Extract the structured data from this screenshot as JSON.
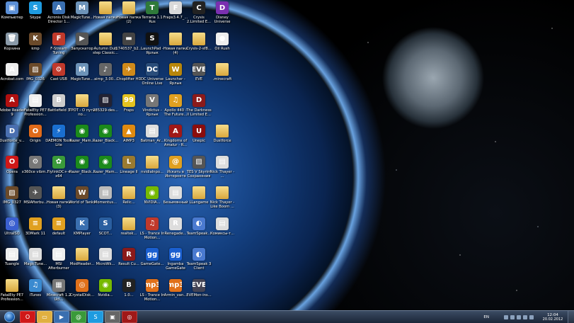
{
  "desktop_icons": [
    {
      "label": "Компьютер",
      "color": "#5b8fd6",
      "glyph": "▣",
      "name": "computer-icon"
    },
    {
      "label": "Skype",
      "color": "#1e9be0",
      "glyph": "S",
      "name": "skype-icon"
    },
    {
      "label": "Acronis Disk Director 1...",
      "color": "#3a6fb0",
      "glyph": "A",
      "name": "acronis-icon"
    },
    {
      "label": "MagicTune...",
      "color": "#6d93b8",
      "glyph": "M",
      "name": "magictune-icon"
    },
    {
      "label": "Новая папка",
      "color": "folder",
      "glyph": "",
      "name": "folder-icon"
    },
    {
      "label": "Новая папка (2)",
      "color": "folder",
      "glyph": "",
      "name": "folder-icon"
    },
    {
      "label": "Terraria 1.1 Rus",
      "color": "#2f7a3a",
      "glyph": "T",
      "name": "terraria-icon"
    },
    {
      "label": "Fraps3.4.7_...",
      "color": "#d9d9d9",
      "glyph": "F",
      "name": "fraps-installer-icon"
    },
    {
      "label": "Crysis 2.Limited E...",
      "color": "#222",
      "glyph": "C",
      "name": "crysis-icon"
    },
    {
      "label": "Disney Universe",
      "color": "#7a2fb0",
      "glyph": "D",
      "name": "disney-icon"
    },
    {
      "label": "Корзина",
      "color": "#8a9aa8",
      "glyph": "🗑",
      "name": "recycle-bin-icon"
    },
    {
      "label": "kmp",
      "color": "#6b4a2a",
      "glyph": "K",
      "name": "kmp-icon"
    },
    {
      "label": "F-Stream Tuning",
      "color": "#c0392b",
      "glyph": "F",
      "name": "fstream-icon"
    },
    {
      "label": "Запускатор",
      "color": "#555",
      "glyph": "▶",
      "name": "launcher-icon"
    },
    {
      "label": "Autumn Dub step Classic...",
      "color": "folder",
      "glyph": "",
      "name": "folder-icon"
    },
    {
      "label": "1740537_b2...",
      "color": "#444",
      "glyph": "▬",
      "name": "file-icon"
    },
    {
      "label": "LaunchPad - Ярлык",
      "color": "#111",
      "glyph": "S",
      "name": "launchpad-icon"
    },
    {
      "label": "Новая папка (4)",
      "color": "folder",
      "glyph": "",
      "name": "folder-icon"
    },
    {
      "label": "Crysis-2-sf8...",
      "color": "folder",
      "glyph": "",
      "name": "folder-icon"
    },
    {
      "label": "Oil Rush",
      "color": "#eee",
      "glyph": "●",
      "name": "oilrush-icon"
    },
    {
      "label": "Acrobat.com",
      "color": "#eee",
      "glyph": "A",
      "name": "acrobat-icon"
    },
    {
      "label": "IMG_0326",
      "color": "#6b4a2a",
      "glyph": "▨",
      "name": "image-file-icon"
    },
    {
      "label": "Cast USB",
      "color": "#c0392b",
      "glyph": "⚙",
      "name": "castusb-icon"
    },
    {
      "label": "MagicTune...",
      "color": "#6d93b8",
      "glyph": "M",
      "name": "magictune-icon"
    },
    {
      "label": "aimp_3.00...",
      "color": "#666",
      "glyph": "♪",
      "name": "aimp-installer-icon"
    },
    {
      "label": "Choplifter HD",
      "color": "#d08a1a",
      "glyph": "✈",
      "name": "choplifter-icon"
    },
    {
      "label": "DC Universe Online Live",
      "color": "#2a4d7a",
      "glyph": "DC",
      "name": "dcuo-icon"
    },
    {
      "label": "Launcher - Ярлык",
      "color": "#b8860b",
      "glyph": "W",
      "name": "wow-launcher-icon"
    },
    {
      "label": "EVE",
      "color": "#555",
      "glyph": "EVE",
      "name": "eve-icon"
    },
    {
      "label": ".minecraft",
      "color": "folder",
      "glyph": "",
      "name": "folder-icon"
    },
    {
      "label": "Adobe Reader 9",
      "color": "#b01010",
      "glyph": "A",
      "name": "adobe-reader-icon"
    },
    {
      "label": "FatalEty PE7 Profession...",
      "color": "#eee",
      "glyph": "▤",
      "name": "document-icon"
    },
    {
      "label": "Battlefield 3",
      "color": "#ccc",
      "glyph": "B",
      "name": "battlefield-icon"
    },
    {
      "label": "ТРОТ - О пути по...",
      "color": "folder",
      "glyph": "",
      "name": "folder-icon"
    },
    {
      "label": "285329-des...",
      "color": "#223",
      "glyph": "▨",
      "name": "image-file-icon"
    },
    {
      "label": "Fraps",
      "color": "#e3c21e",
      "glyph": "99",
      "name": "fraps-icon"
    },
    {
      "label": "Vindictus - Ярлык",
      "color": "#777",
      "glyph": "V",
      "name": "vindictus-icon"
    },
    {
      "label": "Apollo 440 - The Future...",
      "color": "#e0a020",
      "glyph": "♫",
      "name": "music-icon"
    },
    {
      "label": "The Darkness II Limited E...",
      "color": "#8b1a1a",
      "glyph": "D",
      "name": "darkness-icon"
    },
    {
      "label": "",
      "color": "",
      "glyph": "",
      "name": "empty-slot"
    },
    {
      "label": "Dustforce_v...",
      "color": "#4a6fb0",
      "glyph": "D",
      "name": "dustforce-installer-icon"
    },
    {
      "label": "Origin",
      "color": "#e06a1a",
      "glyph": "O",
      "name": "origin-icon"
    },
    {
      "label": "DAEMON Tools Lite",
      "color": "#1a6fd0",
      "glyph": "⚡",
      "name": "daemon-tools-icon"
    },
    {
      "label": "Razer_Mam...",
      "color": "#1b8a1b",
      "glyph": "◉",
      "name": "razer-icon"
    },
    {
      "label": "Razer_Black...",
      "color": "#1b8a1b",
      "glyph": "◉",
      "name": "razer-icon"
    },
    {
      "label": "AIMP3",
      "color": "#e08a10",
      "glyph": "▲",
      "name": "aimp-icon"
    },
    {
      "label": "Batman_Ar...",
      "color": "#ddd",
      "glyph": "▤",
      "name": "document-icon"
    },
    {
      "label": "Kingdoms of Amalur - R...",
      "color": "#a01818",
      "glyph": "A",
      "name": "amalur-icon"
    },
    {
      "label": "Unepic",
      "color": "#8b0d0d",
      "glyph": "U",
      "name": "unepic-icon"
    },
    {
      "label": "Dustforce",
      "color": "folder",
      "glyph": "",
      "name": "folder-icon"
    },
    {
      "label": "Opera",
      "color": "#d01818",
      "glyph": "O",
      "name": "opera-icon"
    },
    {
      "label": "x360ce vibm...",
      "color": "#777",
      "glyph": "⚙",
      "name": "x360ce-icon"
    },
    {
      "label": "FlylinkDC++ x64",
      "color": "#3a9a3a",
      "glyph": "✿",
      "name": "flylink-icon"
    },
    {
      "label": "Razer_Black...",
      "color": "#1b8a1b",
      "glyph": "◉",
      "name": "razer-icon"
    },
    {
      "label": "Razer_Mam...",
      "color": "#1b8a1b",
      "glyph": "◉",
      "name": "razer-icon"
    },
    {
      "label": "Lineage II",
      "color": "#9a7a30",
      "glyph": "L",
      "name": "lineage-icon"
    },
    {
      "label": "nvidiaInpo...",
      "color": "folder",
      "glyph": "",
      "name": "folder-icon"
    },
    {
      "label": "Искать в Интернете",
      "color": "#e0a020",
      "glyph": "@",
      "name": "search-web-icon"
    },
    {
      "label": "TES V Skyrim Сохранения",
      "color": "#555",
      "glyph": "▨",
      "name": "skyrim-saves-icon"
    },
    {
      "label": "Nick Thayer - ...",
      "color": "#ddd",
      "glyph": "▤",
      "name": "document-icon"
    },
    {
      "label": "IMG_0327",
      "color": "#6b4a2a",
      "glyph": "▨",
      "name": "image-file-icon"
    },
    {
      "label": "MSIAfterbu...",
      "color": "#555",
      "glyph": "✈",
      "name": "msi-afterburner-icon"
    },
    {
      "label": "Новая папка (3)",
      "color": "folder",
      "glyph": "",
      "name": "folder-icon"
    },
    {
      "label": "World of Tanks",
      "color": "#6b4a2a",
      "glyph": "W",
      "name": "world-of-tanks-icon"
    },
    {
      "label": "Momentus...",
      "color": "#bbb",
      "glyph": "▤",
      "name": "document-icon"
    },
    {
      "label": "Relic...",
      "color": "folder",
      "glyph": "",
      "name": "folder-icon"
    },
    {
      "label": "NVIDIA...",
      "color": "#76b900",
      "glyph": "◉",
      "name": "nvidia-icon"
    },
    {
      "label": "Безымянный",
      "color": "#ddd",
      "glyph": "▤",
      "name": "document-icon"
    },
    {
      "label": "LLangame",
      "color": "folder",
      "glyph": "",
      "name": "folder-icon"
    },
    {
      "label": "Nick Thayer - Like Boom ...",
      "color": "folder",
      "glyph": "",
      "name": "folder-icon"
    },
    {
      "label": "UltraISO",
      "color": "#3a5fd0",
      "glyph": "◎",
      "name": "ultraiso-icon"
    },
    {
      "label": "3DMark 11",
      "color": "#e0a020",
      "glyph": "≡",
      "name": "3dmark-icon"
    },
    {
      "label": "default",
      "color": "#e0a020",
      "glyph": "≡",
      "name": "default-icon"
    },
    {
      "label": "KMPlayer",
      "color": "#3a6fb0",
      "glyph": "K",
      "name": "kmplayer-icon"
    },
    {
      "label": "SCOT...",
      "color": "#2a5fa0",
      "glyph": "S",
      "name": "scot-icon"
    },
    {
      "label": "realtek...",
      "color": "folder",
      "glyph": "",
      "name": "folder-icon"
    },
    {
      "label": "LS - Trance In Motion...",
      "color": "#c0392b",
      "glyph": "♫",
      "name": "music-icon"
    },
    {
      "label": "Renegade...",
      "color": "#ddd",
      "glyph": "R",
      "name": "renegade-icon"
    },
    {
      "label": "TeamSpeak...",
      "color": "#4a7ad0",
      "glyph": "◐",
      "name": "teamspeak-icon"
    },
    {
      "label": "Комиксы-т...",
      "color": "#ddd",
      "glyph": "▤",
      "name": "document-icon"
    },
    {
      "label": "Tuangle",
      "color": "#eee",
      "glyph": "▤",
      "name": "document-icon"
    },
    {
      "label": "MagicTune...",
      "color": "#ddd",
      "glyph": "▤",
      "name": "document-icon"
    },
    {
      "label": "MSI Afterburner",
      "color": "#eee",
      "glyph": "▤",
      "name": "document-icon"
    },
    {
      "label": "ModHeader...",
      "color": "folder",
      "glyph": "",
      "name": "folder-icon"
    },
    {
      "label": "MicroWk...",
      "color": "#ddd",
      "glyph": "▤",
      "name": "document-icon"
    },
    {
      "label": "Result Cu...",
      "color": "#8b1a1a",
      "glyph": "R",
      "name": "result-icon"
    },
    {
      "label": "GameGate...",
      "color": "#1a5fd0",
      "glyph": "gg",
      "name": "gamegate-icon"
    },
    {
      "label": "Ingamba GameGate",
      "color": "#1a5fd0",
      "glyph": "gg",
      "name": "gamegate-icon"
    },
    {
      "label": "TeamSpeak 3 Client",
      "color": "#4a7ad0",
      "glyph": "◐",
      "name": "teamspeak-icon"
    },
    {
      "label": "",
      "color": "",
      "glyph": "",
      "name": "empty-slot"
    },
    {
      "label": "FatalEty PE7 Profession...",
      "color": "folder",
      "glyph": "",
      "name": "folder-icon"
    },
    {
      "label": "iTunes",
      "color": "#3a8ad0",
      "glyph": "♫",
      "name": "itunes-icon"
    },
    {
      "label": "Minecraft 1.2 Ucl...",
      "color": "#777",
      "glyph": "▦",
      "name": "minecraft-icon"
    },
    {
      "label": "CrystalDisk...",
      "color": "#e0701a",
      "glyph": "◎",
      "name": "crystaldisk-icon"
    },
    {
      "label": "Nvidia...",
      "color": "#76b900",
      "glyph": "◉",
      "name": "nvidia-icon"
    },
    {
      "label": "1.0...",
      "color": "#222",
      "glyph": "B",
      "name": "b-icon"
    },
    {
      "label": "LS - Trance In Motion...",
      "color": "#e0701a",
      "glyph": "mp3",
      "name": "mp3-icon"
    },
    {
      "label": "Armin_van...",
      "color": "#e0701a",
      "glyph": "mp3",
      "name": "mp3-icon"
    },
    {
      "label": "EVEMon-ins...",
      "color": "#445",
      "glyph": "EVE",
      "name": "evemon-icon"
    },
    {
      "label": "",
      "color": "",
      "glyph": "",
      "name": "empty-slot"
    }
  ],
  "taskbar": {
    "items": [
      {
        "name": "opera-taskbar-button",
        "glyph": "O",
        "color": "#d01818"
      },
      {
        "name": "explorer-taskbar-button",
        "glyph": "▭",
        "color": "#e0b040"
      },
      {
        "name": "media-taskbar-button",
        "glyph": "▶",
        "color": "#3a6fb0"
      },
      {
        "name": "flylink-taskbar-button",
        "glyph": "@",
        "color": "#3a9a3a"
      },
      {
        "name": "skype-taskbar-button",
        "glyph": "S",
        "color": "#1e9be0"
      },
      {
        "name": "app-taskbar-button",
        "glyph": "▣",
        "color": "#666"
      },
      {
        "name": "opera2-taskbar-button",
        "glyph": "◎",
        "color": "#a01818"
      }
    ],
    "language": "EN",
    "time": "12:04",
    "date": "20.02.2012"
  }
}
